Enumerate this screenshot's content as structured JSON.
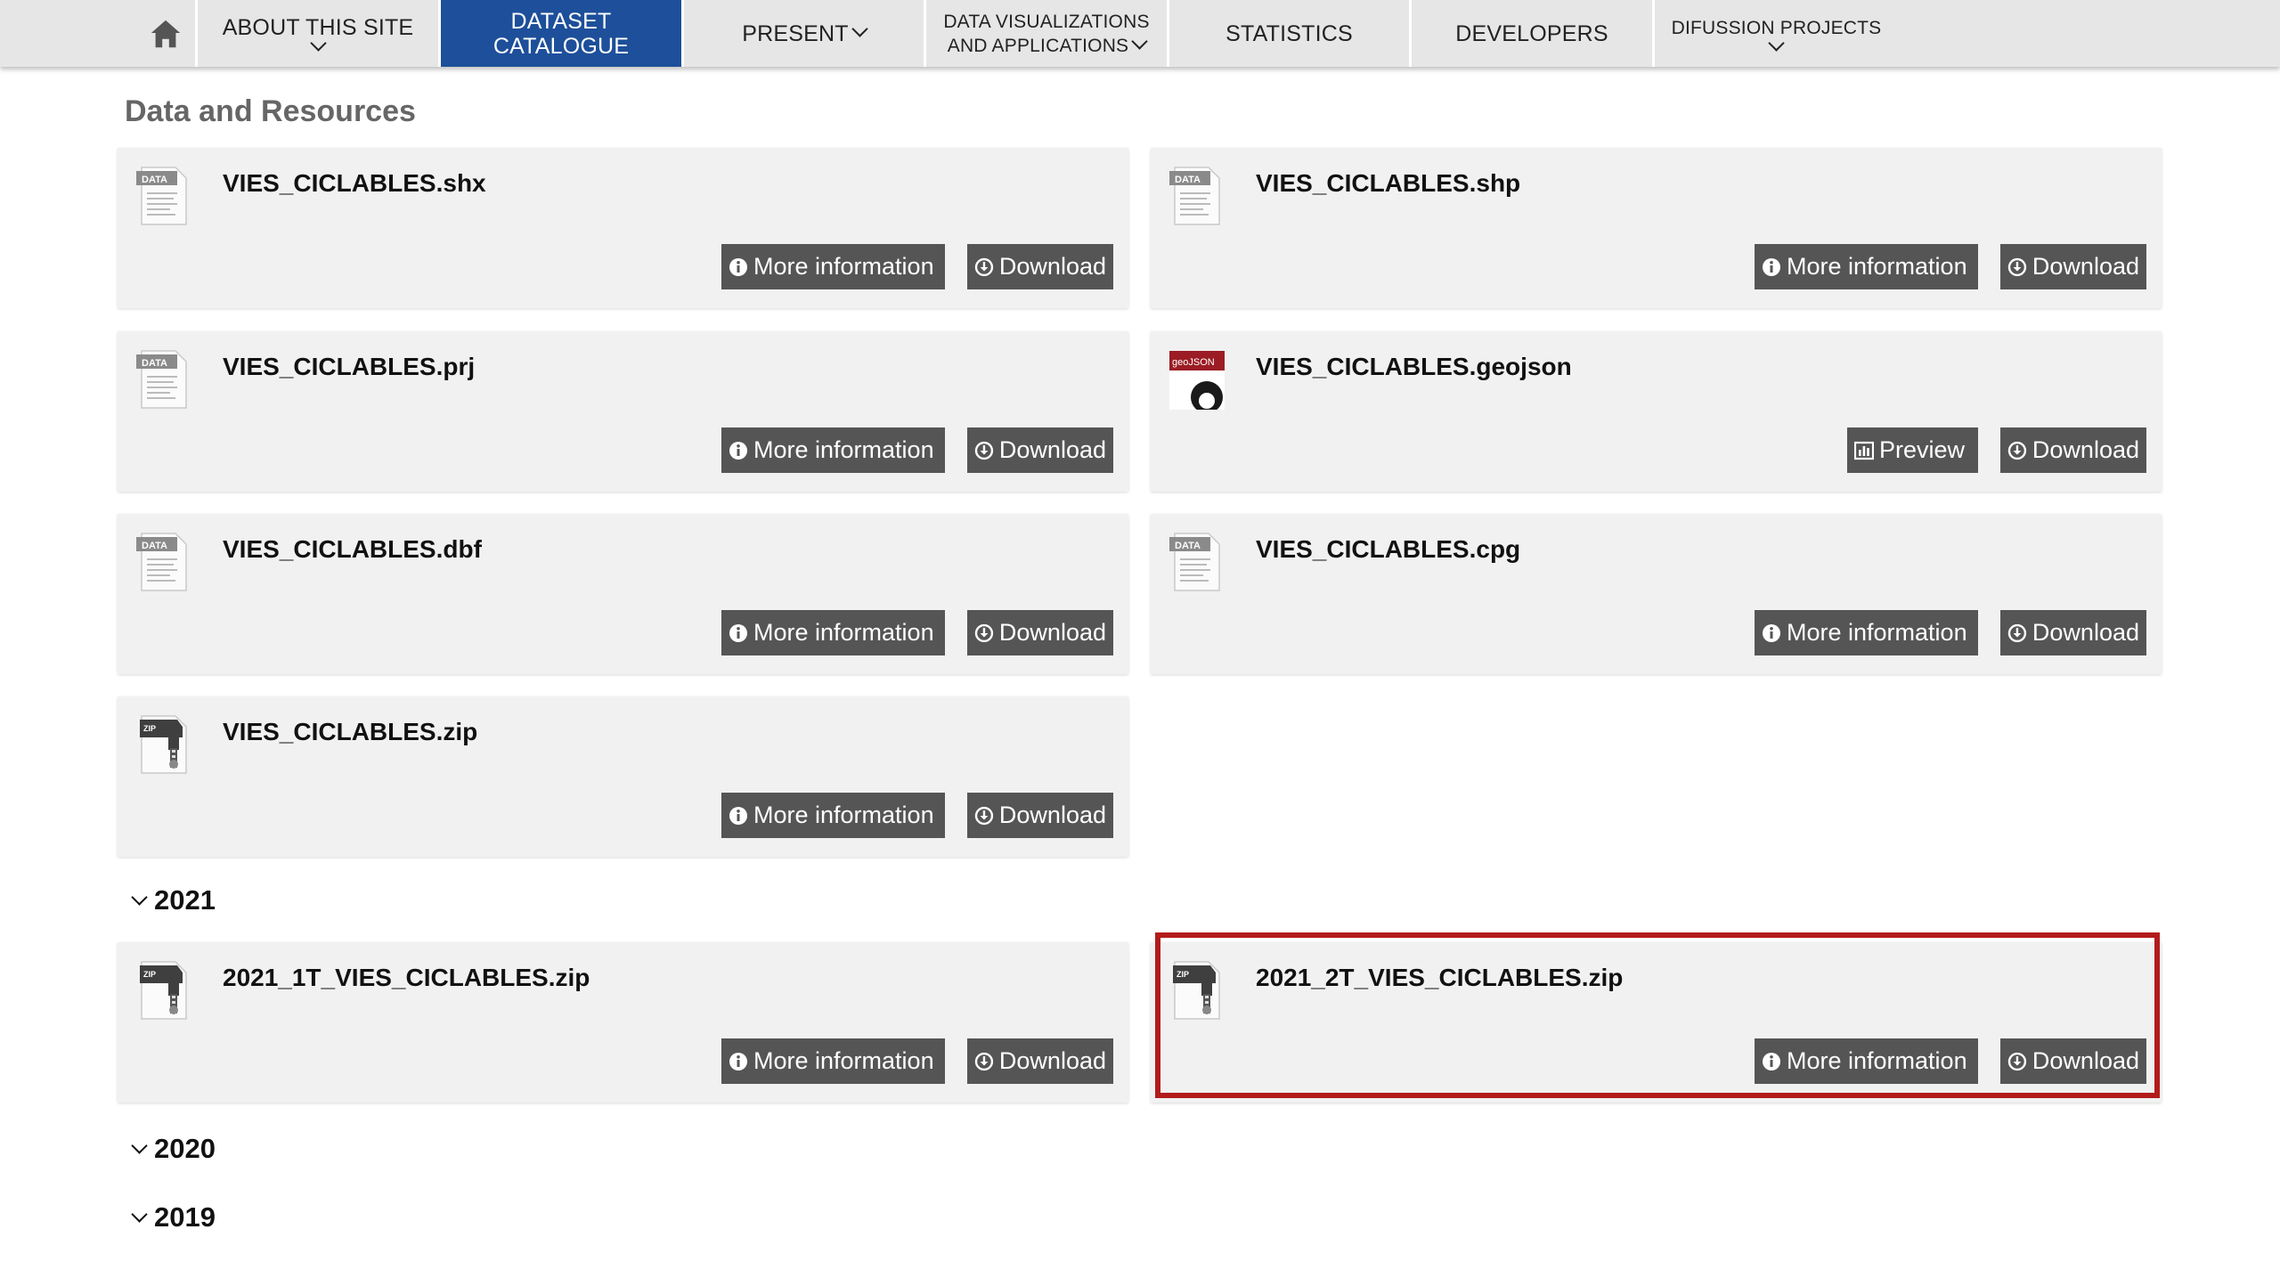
{
  "nav": {
    "about": "ABOUT THIS SITE",
    "catalogue_line1": "DATASET",
    "catalogue_line2": "CATALOGUE",
    "present": "PRESENT",
    "dataviz_line1": "DATA VISUALIZATIONS",
    "dataviz_line2": "AND APPLICATIONS",
    "statistics": "STATISTICS",
    "developers": "DEVELOPERS",
    "difussion": "DIFUSSION PROJECTS",
    "active_color": "#1d4f9a"
  },
  "section_title": "Data and Resources",
  "buttons": {
    "more_info": "More information",
    "download": "Download",
    "preview": "Preview"
  },
  "resources": [
    {
      "name": "VIES_CICLABLES.shx",
      "icon": "data-file-icon"
    },
    {
      "name": "VIES_CICLABLES.shp",
      "icon": "data-file-icon"
    },
    {
      "name": "VIES_CICLABLES.prj",
      "icon": "data-file-icon"
    },
    {
      "name": "VIES_CICLABLES.geojson",
      "icon": "geojson-file-icon"
    },
    {
      "name": "VIES_CICLABLES.dbf",
      "icon": "data-file-icon"
    },
    {
      "name": "VIES_CICLABLES.cpg",
      "icon": "data-file-icon"
    },
    {
      "name": "VIES_CICLABLES.zip",
      "icon": "zip-file-icon"
    }
  ],
  "years": [
    "2021",
    "2020",
    "2019"
  ],
  "resources_2021": [
    {
      "name": "2021_1T_VIES_CICLABLES.zip",
      "icon": "zip-file-icon"
    },
    {
      "name": "2021_2T_VIES_CICLABLES.zip",
      "icon": "zip-file-icon"
    }
  ],
  "highlight_color": "#b31b1b"
}
